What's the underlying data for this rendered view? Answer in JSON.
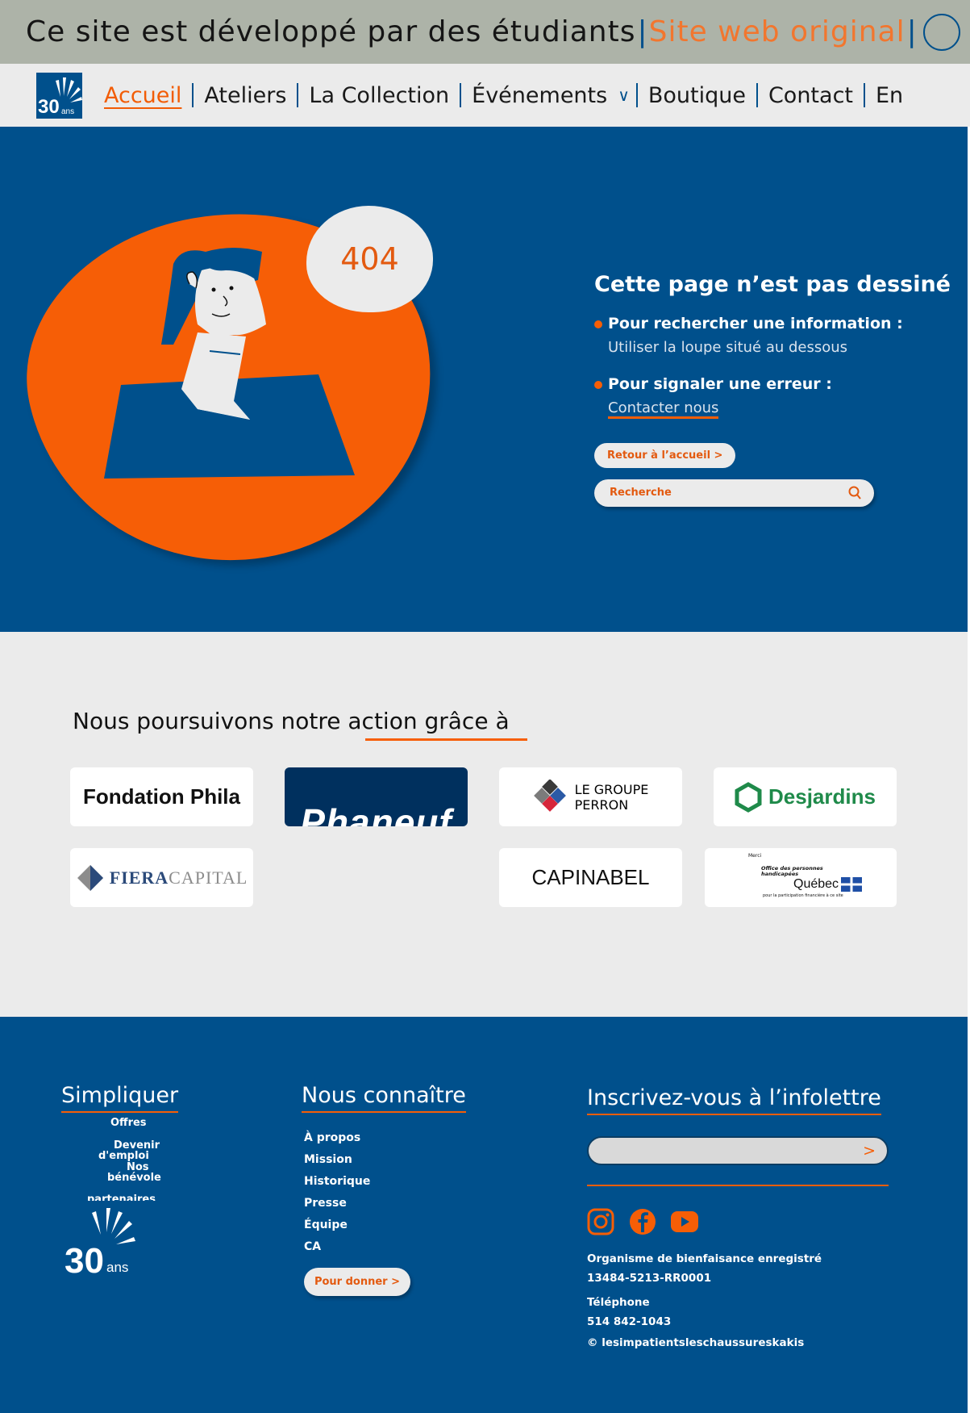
{
  "banner": {
    "message": "Ce site est développé par des étudiants",
    "separator": "|",
    "original_link": "Site web original"
  },
  "nav": {
    "logo_number": "30",
    "logo_suffix": "ans",
    "items": [
      {
        "label": "Accueil"
      },
      {
        "label": "Ateliers"
      },
      {
        "label": "La Collection"
      },
      {
        "label": "Événements"
      },
      {
        "label": "Boutique"
      },
      {
        "label": "Contact"
      },
      {
        "label": "En"
      }
    ],
    "chevron": "∨"
  },
  "hero": {
    "code": "404",
    "title": "Cette page n’est pas dessiné",
    "item1_head": "Pour rechercher une information :",
    "item1_sub": "Utiliser la loupe situé au dessous",
    "item2_head": "Pour signaler une erreur :",
    "item2_link": "Contacter nous",
    "back_button": "Retour à l’accueil >",
    "search_placeholder": "Recherche"
  },
  "partners": {
    "title": "Nous poursuivons notre action grâce à",
    "logos": {
      "phila": "Fondation Phila",
      "phaneuf": "Phaneuf",
      "perron_top": "LE GROUPE",
      "perron_bottom": "PERRON",
      "desjardins": "Desjardins",
      "fiera_a": "FIERA",
      "fiera_b": "CAPITAL",
      "capinabel": "CAPINABEL",
      "oph_merci": "Merci",
      "oph_line1": "Office des personnes",
      "oph_line2": "handicapées",
      "oph_quebec": "Québec",
      "oph_note": "pour la participation financière à ce site"
    }
  },
  "footer": {
    "col1_title": "Simpliquer",
    "col1_links": [
      "Offres",
      "Devenir",
      "d'emploi",
      "Nos",
      "bénévole",
      "partenaires"
    ],
    "col2_title": "Nous connaître",
    "col2_links": [
      "À propos",
      "Mission",
      "Historique",
      "Presse",
      "Équipe",
      "CA"
    ],
    "donate_button": "Pour donner >",
    "col3_title": "Inscrivez-vous à l’infolettre",
    "newsletter_arrow": ">",
    "charity_label": "Organisme de bienfaisance enregistré",
    "charity_number": "13484-5213-RR0001",
    "phone_label": "Téléphone",
    "phone_number": "514 842-1043",
    "copyright": "© lesimpatientsleschaussureskakis",
    "logo_number": "30",
    "logo_suffix": "ans"
  },
  "colors": {
    "primary_blue": "#00508c",
    "accent_orange": "#f65e06",
    "light_gray": "#ebebeb",
    "banner_gray": "#adb3a8"
  }
}
